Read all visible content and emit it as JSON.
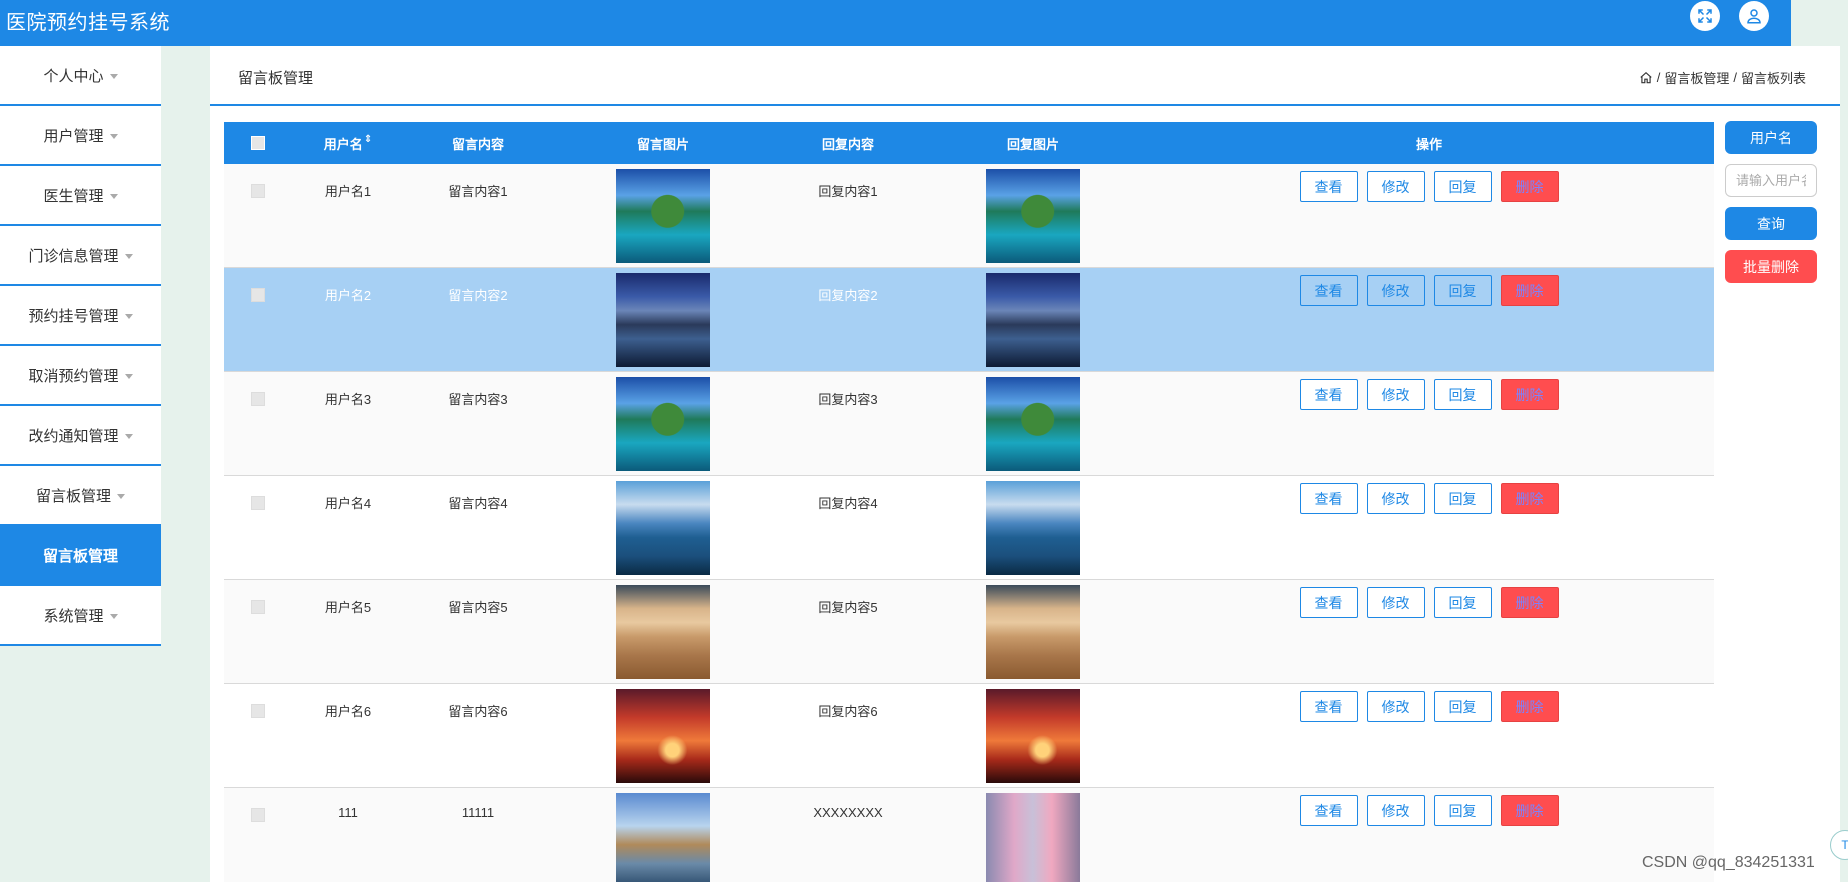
{
  "app": {
    "title": "医院预约挂号系统"
  },
  "topbar": {
    "fullscreen_icon": "fullscreen-icon",
    "user_icon": "user-icon"
  },
  "sidebar": {
    "items": [
      {
        "label": "个人中心",
        "caret": true,
        "active": false
      },
      {
        "label": "用户管理",
        "caret": true,
        "active": false
      },
      {
        "label": "医生管理",
        "caret": true,
        "active": false
      },
      {
        "label": "门诊信息管理",
        "caret": true,
        "active": false
      },
      {
        "label": "预约挂号管理",
        "caret": true,
        "active": false
      },
      {
        "label": "取消预约管理",
        "caret": true,
        "active": false
      },
      {
        "label": "改约通知管理",
        "caret": true,
        "active": false
      },
      {
        "label": "留言板管理",
        "caret": true,
        "active": false
      },
      {
        "label": "留言板管理",
        "caret": false,
        "active": true
      },
      {
        "label": "系统管理",
        "caret": true,
        "active": false
      }
    ]
  },
  "header": {
    "page_title": "留言板管理",
    "breadcrumb": [
      "留言板管理",
      "留言板列表"
    ],
    "separator": "/"
  },
  "table": {
    "columns": {
      "user": "用户名",
      "message": "留言内容",
      "image": "留言图片",
      "reply": "回复内容",
      "reply_image": "回复图片",
      "ops": "操作"
    },
    "sort_icon": "⇕",
    "actions": {
      "view": "查看",
      "edit": "修改",
      "reply": "回复",
      "delete": "删除"
    },
    "rows": [
      {
        "user": "用户名1",
        "message": "留言内容1",
        "reply": "回复内容1",
        "image": "island-lagoon",
        "reply_image": "island-lagoon",
        "selected": false
      },
      {
        "user": "用户名2",
        "message": "留言内容2",
        "reply": "回复内容2",
        "image": "mountain-lake-night",
        "reply_image": "mountain-lake-night",
        "selected": true
      },
      {
        "user": "用户名3",
        "message": "留言内容3",
        "reply": "回复内容3",
        "image": "island-lagoon",
        "reply_image": "island-lagoon",
        "selected": false
      },
      {
        "user": "用户名4",
        "message": "留言内容4",
        "reply": "回复内容4",
        "image": "blue-lake-sky",
        "reply_image": "blue-lake-sky",
        "selected": false
      },
      {
        "user": "用户名5",
        "message": "留言内容5",
        "reply": "回复内容5",
        "image": "desert-sunset",
        "reply_image": "desert-sunset",
        "selected": false
      },
      {
        "user": "用户名6",
        "message": "留言内容6",
        "reply": "回复内容6",
        "image": "red-sunset-tree",
        "reply_image": "red-sunset-tree",
        "selected": false
      },
      {
        "user": "111",
        "message": "11111",
        "reply": "XXXXXXXX",
        "image": "castle-island",
        "reply_image": "waterfall-pink",
        "selected": false
      }
    ]
  },
  "search": {
    "label": "用户名",
    "placeholder": "请输入用户名",
    "query_button": "查询",
    "batch_delete_button": "批量删除"
  },
  "watermark": "CSDN @qq_834251331",
  "float_button": "T",
  "colors": {
    "primary": "#1e88e5",
    "danger": "#ff4d4f",
    "selected_row": "#a7d0f4",
    "background": "#e6f2ec"
  }
}
